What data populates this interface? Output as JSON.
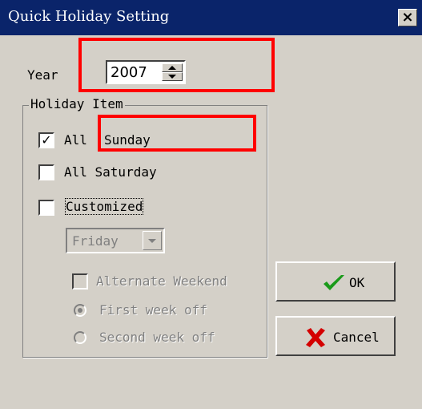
{
  "window": {
    "title": "Quick Holiday Setting",
    "close_label": "×"
  },
  "year": {
    "label": "Year",
    "value": "2007"
  },
  "holiday_item": {
    "group_label": "Holiday Item",
    "all_sunday": {
      "prefix": "All",
      "day": "Sunday",
      "checked": true,
      "check_mark": "✓"
    },
    "all_saturday": {
      "label": "All Saturday",
      "checked": false
    },
    "customized": {
      "label": "Customized",
      "checked": false
    },
    "day_select": {
      "value": "Friday"
    },
    "alternate_weekend": {
      "label": "Alternate Weekend",
      "checked": false
    },
    "first_week_off": {
      "label": "First week off",
      "selected": true
    },
    "second_week_off": {
      "label": "Second week off",
      "selected": false
    }
  },
  "buttons": {
    "ok": "OK",
    "cancel": "Cancel"
  },
  "colors": {
    "title_bar": "#0a246a",
    "face": "#d4d0c8",
    "highlight": "#ff0000",
    "ok_icon": "#1a9a1a",
    "cancel_icon": "#d40000"
  },
  "icons": {
    "ok": "green-checkmark-icon",
    "cancel": "red-x-icon",
    "close": "close-icon"
  }
}
